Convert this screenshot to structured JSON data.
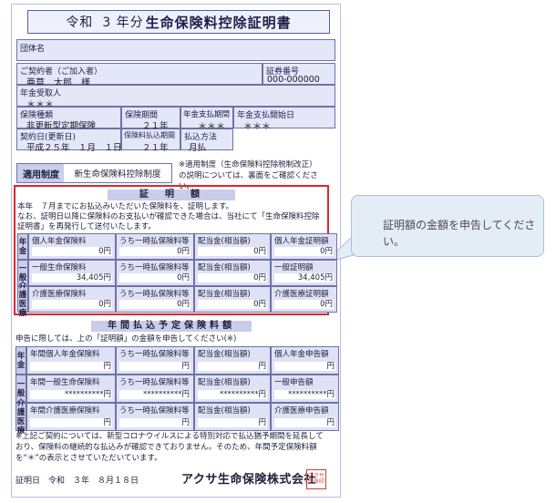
{
  "title": {
    "era": "令和",
    "year": "3 年分",
    "main": "生命保険料控除証明書"
  },
  "group": {
    "label": "団体名",
    "value": ""
  },
  "contractor": {
    "label": "ご契約者（ご加入者）",
    "value": "亜草　太郎　様"
  },
  "policy_no": {
    "label": "証券番号",
    "value": "000-000000"
  },
  "pension_recipient": {
    "label": "年金受取人",
    "value": "＊＊＊"
  },
  "insurance_type": {
    "label": "保険種類",
    "value": "非更新型定期保険"
  },
  "insurance_period": {
    "label": "保険期間",
    "value": "２１年"
  },
  "pension_pay_period": {
    "label": "年金支払期間",
    "value": "＊＊＊"
  },
  "pension_start": {
    "label": "年金支払開始日",
    "value": "＊＊＊"
  },
  "contract_date": {
    "label": "契約日(更新日)",
    "value": "平成２５年　１月　１日"
  },
  "premium_period": {
    "label": "保険料払込期間",
    "value": "２１年"
  },
  "payment_method": {
    "label": "払込方法",
    "value": "月払"
  },
  "tekiyo": {
    "label": "適用制度",
    "value": "新生命保険料控除制度",
    "note": "※適用制度（生命保険料控除税制改正）の説明については、裏面をご確認ください。"
  },
  "cert": {
    "title": "証　明　額",
    "intro1": "本年　７月までにお払込みいただいた保険料を、証明します。",
    "intro2": "なお、証明日以降に保険料のお支払いが確認できた場合は、当社にて「生命保険料控除",
    "intro3": "証明書」を再発行して送付いたします。",
    "rows": [
      {
        "head": "年金",
        "cells": [
          {
            "label": "個人年金保険料",
            "value": "0円"
          },
          {
            "label": "うち一時払保険料等",
            "value": "0円"
          },
          {
            "label": "配当金(相当額)",
            "value": "0円"
          },
          {
            "label": "個人年金証明額",
            "value": "0円"
          }
        ]
      },
      {
        "head": "一般",
        "cells": [
          {
            "label": "一般生命保険料",
            "value": "34,405円"
          },
          {
            "label": "うち一時払保険料等",
            "value": "0円"
          },
          {
            "label": "配当金(相当額)",
            "value": "0円"
          },
          {
            "label": "一般証明額",
            "value": "34,405円"
          }
        ]
      },
      {
        "head": "介護医療",
        "cells": [
          {
            "label": "介護医療保険料",
            "value": "0円"
          },
          {
            "label": "うち一時払保険料等",
            "value": "0円"
          },
          {
            "label": "配当金(相当額)",
            "value": "0円"
          },
          {
            "label": "介護医療証明額",
            "value": "0円"
          }
        ]
      }
    ]
  },
  "planned": {
    "title": "年間払込予定保険料額",
    "intro": "申告に際しては、上の「証明額」の金額を申告してください(※)",
    "rows": [
      {
        "head": "年金",
        "cells": [
          {
            "label": "年間個人年金保険料",
            "value": "円"
          },
          {
            "label": "うち一時払保険料等",
            "value": "円"
          },
          {
            "label": "配当金(相当額)",
            "value": "円"
          },
          {
            "label": "個人年金申告額",
            "value": "円"
          }
        ]
      },
      {
        "head": "一般",
        "cells": [
          {
            "label": "年間一般生命保険料",
            "value": "**********円"
          },
          {
            "label": "うち一時払保険料等",
            "value": "**********円"
          },
          {
            "label": "配当金(相当額)",
            "value": "**********円"
          },
          {
            "label": "一般申告額",
            "value": "**********円"
          }
        ]
      },
      {
        "head": "介護医療",
        "cells": [
          {
            "label": "年間介護医療保険料",
            "value": "円"
          },
          {
            "label": "うち一時払保険料等",
            "value": "円"
          },
          {
            "label": "配当金(相当額)",
            "value": "円"
          },
          {
            "label": "介護医療申告額",
            "value": "円"
          }
        ]
      }
    ]
  },
  "footer": {
    "note": "※上記ご契約については、新型コロナウイルスによる特別対応で払込猶予期間を延長しており、保険料の継続的な払込みが確認できておりません。そのため、年間予定保険料額を“＊”の表示とさせていただいています。",
    "issue_date": "証明日　令和　３年　８月１８日",
    "company": "アクサ生命保険株式会社",
    "seal": "アクサ生命印"
  },
  "callout": {
    "text": "証明額の金額を申告してください。"
  }
}
